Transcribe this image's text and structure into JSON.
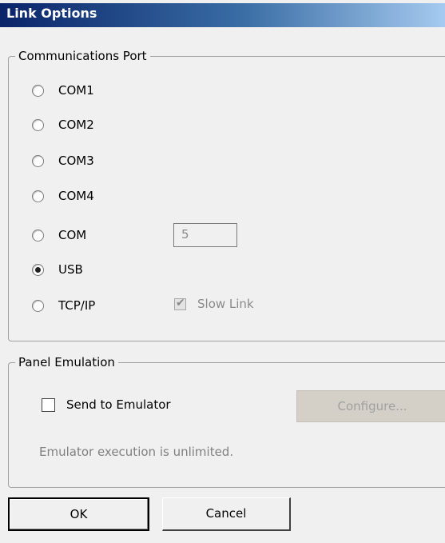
{
  "window": {
    "title": "Link Options"
  },
  "comm_port": {
    "legend": "Communications Port",
    "options": [
      "COM1",
      "COM2",
      "COM3",
      "COM4",
      "COM",
      "USB",
      "TCP/IP"
    ],
    "selected": "USB",
    "com_number_value": "5",
    "slow_link": {
      "label": "Slow Link",
      "checked": true,
      "enabled": false
    }
  },
  "panel_emulation": {
    "legend": "Panel Emulation",
    "send_to_emulator": {
      "label": "Send to Emulator",
      "checked": false
    },
    "configure_label": "Configure...",
    "status_text": "Emulator execution is unlimited."
  },
  "buttons": {
    "ok": "OK",
    "cancel": "Cancel"
  }
}
